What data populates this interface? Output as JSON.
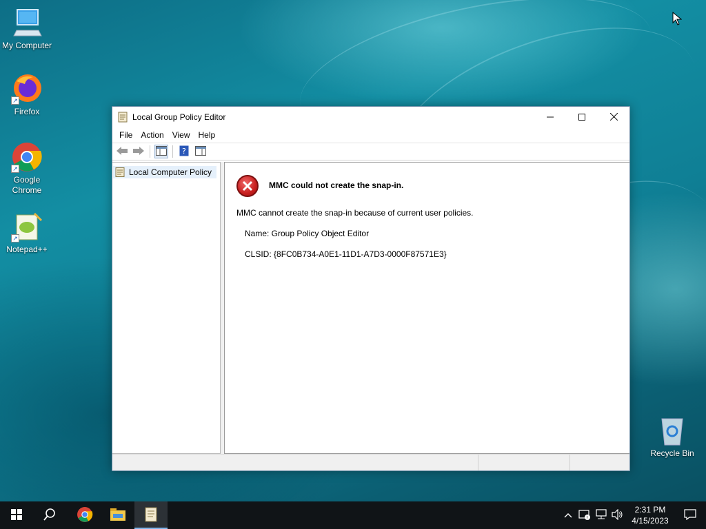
{
  "desktop": {
    "icons": [
      {
        "label": "My Computer",
        "icon": "computer-icon"
      },
      {
        "label": "Firefox",
        "icon": "firefox-icon"
      },
      {
        "label_line1": "Google",
        "label_line2": "Chrome",
        "icon": "chrome-icon"
      },
      {
        "label": "Notepad++",
        "icon": "notepadpp-icon"
      },
      {
        "label": "Recycle Bin",
        "icon": "recycle-bin-icon"
      }
    ]
  },
  "window": {
    "title": "Local Group Policy Editor",
    "controls": {
      "minimize": "minimize-icon",
      "maximize": "maximize-icon",
      "close": "close-icon"
    },
    "menu": [
      "File",
      "Action",
      "View",
      "Help"
    ],
    "toolbar": [
      "back-arrow-icon",
      "forward-arrow-icon",
      "show-hide-tree-icon",
      "help-icon",
      "action-pane-icon"
    ],
    "tree": {
      "root": "Local Computer Policy"
    },
    "error": {
      "title": "MMC could not create the snap-in.",
      "message": "MMC cannot create the snap-in because of current user policies.",
      "name_line": "Name: Group Policy Object Editor",
      "clsid_line": "CLSID: {8FC0B734-A0E1-11D1-A7D3-0000F87571E3}",
      "icon": "error-icon"
    }
  },
  "taskbar": {
    "items": [
      "start-icon",
      "search-icon",
      "chrome-icon",
      "file-explorer-icon",
      "gpedit-icon"
    ],
    "tray": [
      "chevron-up-icon",
      "network-warning-icon",
      "network-icon",
      "volume-icon"
    ],
    "time": "2:31 PM",
    "date": "4/15/2023",
    "notification": "notification-icon"
  },
  "colors": {
    "taskbar_bg": "#101417",
    "error_red": "#c81f1f",
    "selection": "#e5f0fb"
  }
}
